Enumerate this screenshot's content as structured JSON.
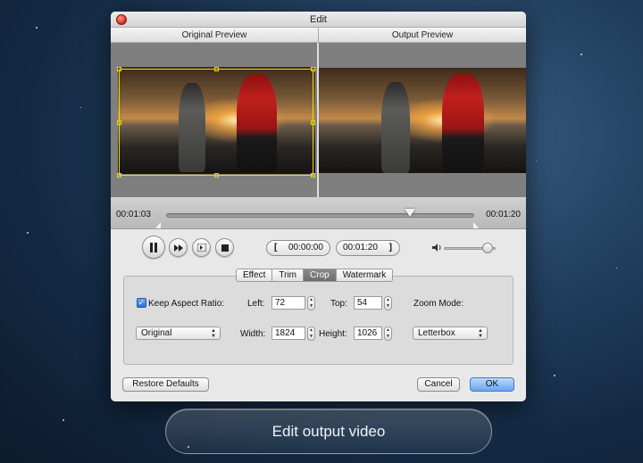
{
  "window": {
    "title": "Edit"
  },
  "preview": {
    "original_label": "Original Preview",
    "output_label": "Output Preview"
  },
  "timeline": {
    "current_time": "00:01:03",
    "end_time": "00:01:20",
    "position_fraction": 0.79
  },
  "playback": {
    "pause_icon": "pause-icon",
    "forward_icon": "fast-forward-icon",
    "frame_icon": "next-frame-icon",
    "stop_icon": "stop-icon",
    "start_bracket": "[",
    "start_time": "00:00:00",
    "end_time": "00:01:20",
    "end_bracket": "]",
    "volume_icon": "speaker-icon",
    "volume_fraction": 0.85
  },
  "tabs": [
    {
      "label": "Effect"
    },
    {
      "label": "Trim"
    },
    {
      "label": "Crop"
    },
    {
      "label": "Watermark"
    }
  ],
  "crop": {
    "keep_aspect_label": "Keep Aspect Ratio:",
    "keep_aspect_checked": true,
    "checkmark": "✓",
    "left_label": "Left:",
    "left_value": "72",
    "top_label": "Top:",
    "top_value": "54",
    "zoom_label": "Zoom Mode:",
    "aspect_select": "Original",
    "width_label": "Width:",
    "width_value": "1824",
    "height_label": "Height:",
    "height_value": "1026",
    "zoom_select": "Letterbox"
  },
  "buttons": {
    "restore": "Restore Defaults",
    "cancel": "Cancel",
    "ok": "OK"
  },
  "caption": "Edit output video"
}
